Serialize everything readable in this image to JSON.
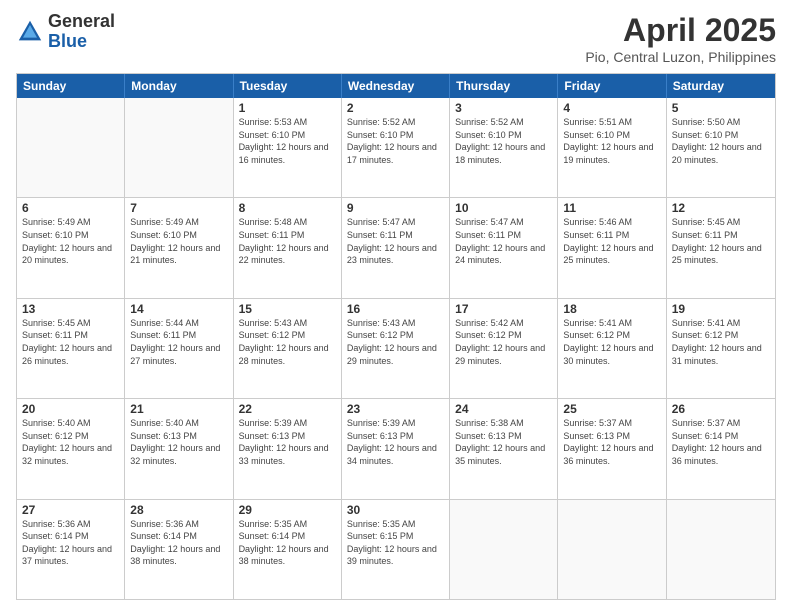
{
  "logo": {
    "general": "General",
    "blue": "Blue"
  },
  "header": {
    "title": "April 2025",
    "subtitle": "Pio, Central Luzon, Philippines"
  },
  "days_of_week": [
    "Sunday",
    "Monday",
    "Tuesday",
    "Wednesday",
    "Thursday",
    "Friday",
    "Saturday"
  ],
  "weeks": [
    [
      {
        "day": "",
        "info": ""
      },
      {
        "day": "",
        "info": ""
      },
      {
        "day": "1",
        "info": "Sunrise: 5:53 AM\nSunset: 6:10 PM\nDaylight: 12 hours and 16 minutes."
      },
      {
        "day": "2",
        "info": "Sunrise: 5:52 AM\nSunset: 6:10 PM\nDaylight: 12 hours and 17 minutes."
      },
      {
        "day": "3",
        "info": "Sunrise: 5:52 AM\nSunset: 6:10 PM\nDaylight: 12 hours and 18 minutes."
      },
      {
        "day": "4",
        "info": "Sunrise: 5:51 AM\nSunset: 6:10 PM\nDaylight: 12 hours and 19 minutes."
      },
      {
        "day": "5",
        "info": "Sunrise: 5:50 AM\nSunset: 6:10 PM\nDaylight: 12 hours and 20 minutes."
      }
    ],
    [
      {
        "day": "6",
        "info": "Sunrise: 5:49 AM\nSunset: 6:10 PM\nDaylight: 12 hours and 20 minutes."
      },
      {
        "day": "7",
        "info": "Sunrise: 5:49 AM\nSunset: 6:10 PM\nDaylight: 12 hours and 21 minutes."
      },
      {
        "day": "8",
        "info": "Sunrise: 5:48 AM\nSunset: 6:11 PM\nDaylight: 12 hours and 22 minutes."
      },
      {
        "day": "9",
        "info": "Sunrise: 5:47 AM\nSunset: 6:11 PM\nDaylight: 12 hours and 23 minutes."
      },
      {
        "day": "10",
        "info": "Sunrise: 5:47 AM\nSunset: 6:11 PM\nDaylight: 12 hours and 24 minutes."
      },
      {
        "day": "11",
        "info": "Sunrise: 5:46 AM\nSunset: 6:11 PM\nDaylight: 12 hours and 25 minutes."
      },
      {
        "day": "12",
        "info": "Sunrise: 5:45 AM\nSunset: 6:11 PM\nDaylight: 12 hours and 25 minutes."
      }
    ],
    [
      {
        "day": "13",
        "info": "Sunrise: 5:45 AM\nSunset: 6:11 PM\nDaylight: 12 hours and 26 minutes."
      },
      {
        "day": "14",
        "info": "Sunrise: 5:44 AM\nSunset: 6:11 PM\nDaylight: 12 hours and 27 minutes."
      },
      {
        "day": "15",
        "info": "Sunrise: 5:43 AM\nSunset: 6:12 PM\nDaylight: 12 hours and 28 minutes."
      },
      {
        "day": "16",
        "info": "Sunrise: 5:43 AM\nSunset: 6:12 PM\nDaylight: 12 hours and 29 minutes."
      },
      {
        "day": "17",
        "info": "Sunrise: 5:42 AM\nSunset: 6:12 PM\nDaylight: 12 hours and 29 minutes."
      },
      {
        "day": "18",
        "info": "Sunrise: 5:41 AM\nSunset: 6:12 PM\nDaylight: 12 hours and 30 minutes."
      },
      {
        "day": "19",
        "info": "Sunrise: 5:41 AM\nSunset: 6:12 PM\nDaylight: 12 hours and 31 minutes."
      }
    ],
    [
      {
        "day": "20",
        "info": "Sunrise: 5:40 AM\nSunset: 6:12 PM\nDaylight: 12 hours and 32 minutes."
      },
      {
        "day": "21",
        "info": "Sunrise: 5:40 AM\nSunset: 6:13 PM\nDaylight: 12 hours and 32 minutes."
      },
      {
        "day": "22",
        "info": "Sunrise: 5:39 AM\nSunset: 6:13 PM\nDaylight: 12 hours and 33 minutes."
      },
      {
        "day": "23",
        "info": "Sunrise: 5:39 AM\nSunset: 6:13 PM\nDaylight: 12 hours and 34 minutes."
      },
      {
        "day": "24",
        "info": "Sunrise: 5:38 AM\nSunset: 6:13 PM\nDaylight: 12 hours and 35 minutes."
      },
      {
        "day": "25",
        "info": "Sunrise: 5:37 AM\nSunset: 6:13 PM\nDaylight: 12 hours and 36 minutes."
      },
      {
        "day": "26",
        "info": "Sunrise: 5:37 AM\nSunset: 6:14 PM\nDaylight: 12 hours and 36 minutes."
      }
    ],
    [
      {
        "day": "27",
        "info": "Sunrise: 5:36 AM\nSunset: 6:14 PM\nDaylight: 12 hours and 37 minutes."
      },
      {
        "day": "28",
        "info": "Sunrise: 5:36 AM\nSunset: 6:14 PM\nDaylight: 12 hours and 38 minutes."
      },
      {
        "day": "29",
        "info": "Sunrise: 5:35 AM\nSunset: 6:14 PM\nDaylight: 12 hours and 38 minutes."
      },
      {
        "day": "30",
        "info": "Sunrise: 5:35 AM\nSunset: 6:15 PM\nDaylight: 12 hours and 39 minutes."
      },
      {
        "day": "",
        "info": ""
      },
      {
        "day": "",
        "info": ""
      },
      {
        "day": "",
        "info": ""
      }
    ]
  ]
}
